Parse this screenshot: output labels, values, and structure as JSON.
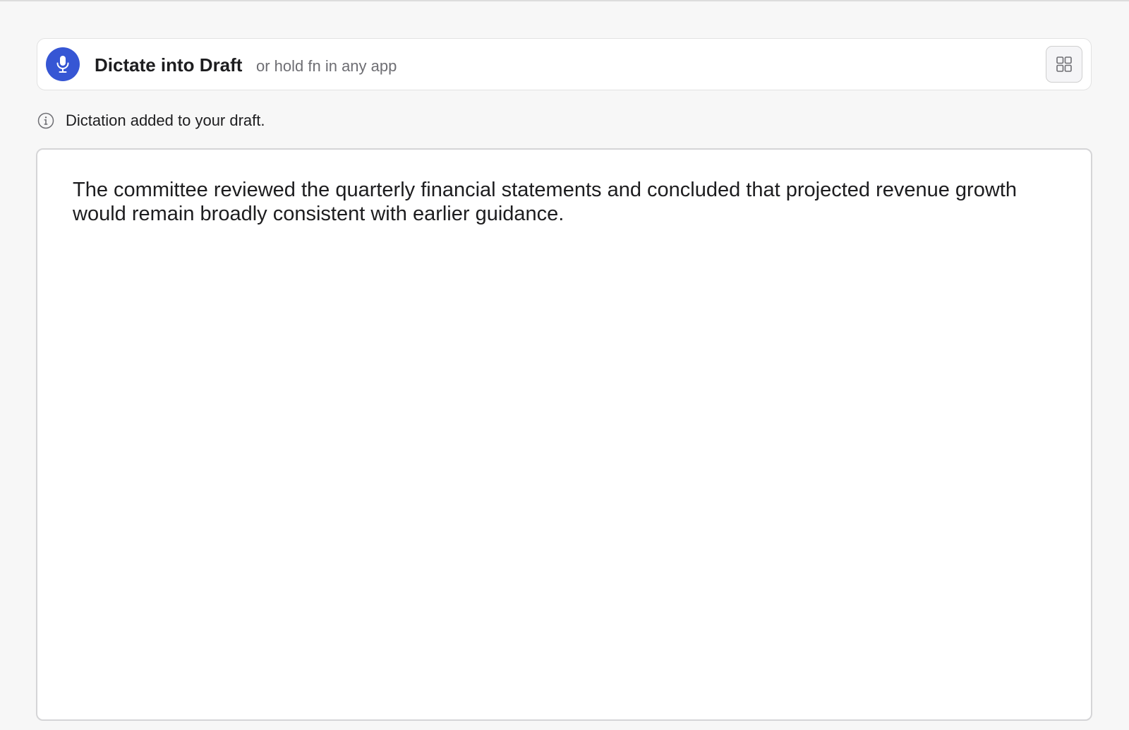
{
  "dictate_bar": {
    "title": "Dictate into Draft",
    "hint": "or hold fn in any app",
    "mic_icon": "microphone-icon",
    "grid_icon": "grid-icon",
    "accent_color": "#3656d4"
  },
  "status": {
    "icon": "info-icon",
    "message": "Dictation added to your draft."
  },
  "editor": {
    "text": "The committee reviewed the quarterly financial statements and concluded that projected revenue growth would remain broadly consistent with earlier guidance."
  }
}
